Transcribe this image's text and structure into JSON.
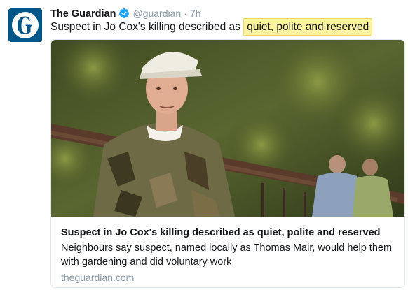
{
  "tweet": {
    "author_name": "The Guardian",
    "handle": "@guardian",
    "separator": "·",
    "time": "7h",
    "avatar_icon": "guardian-g-logo",
    "verified_icon": "verified-badge-icon",
    "text_before": "Suspect in Jo Cox's killing described as ",
    "text_highlight": "quiet, polite and reserved"
  },
  "card": {
    "image_description_icon": "article-photo",
    "title": "Suspect in Jo Cox's killing described as quiet, polite and reserved",
    "description": "Neighbours say suspect, named locally as Thomas Mair, would help them with gardening and did voluntary work",
    "domain": "theguardian.com"
  },
  "colors": {
    "brand": "#005689",
    "verified": "#1da1f2",
    "highlight": "#fdf2a0",
    "secondary_text": "#8899a6"
  }
}
